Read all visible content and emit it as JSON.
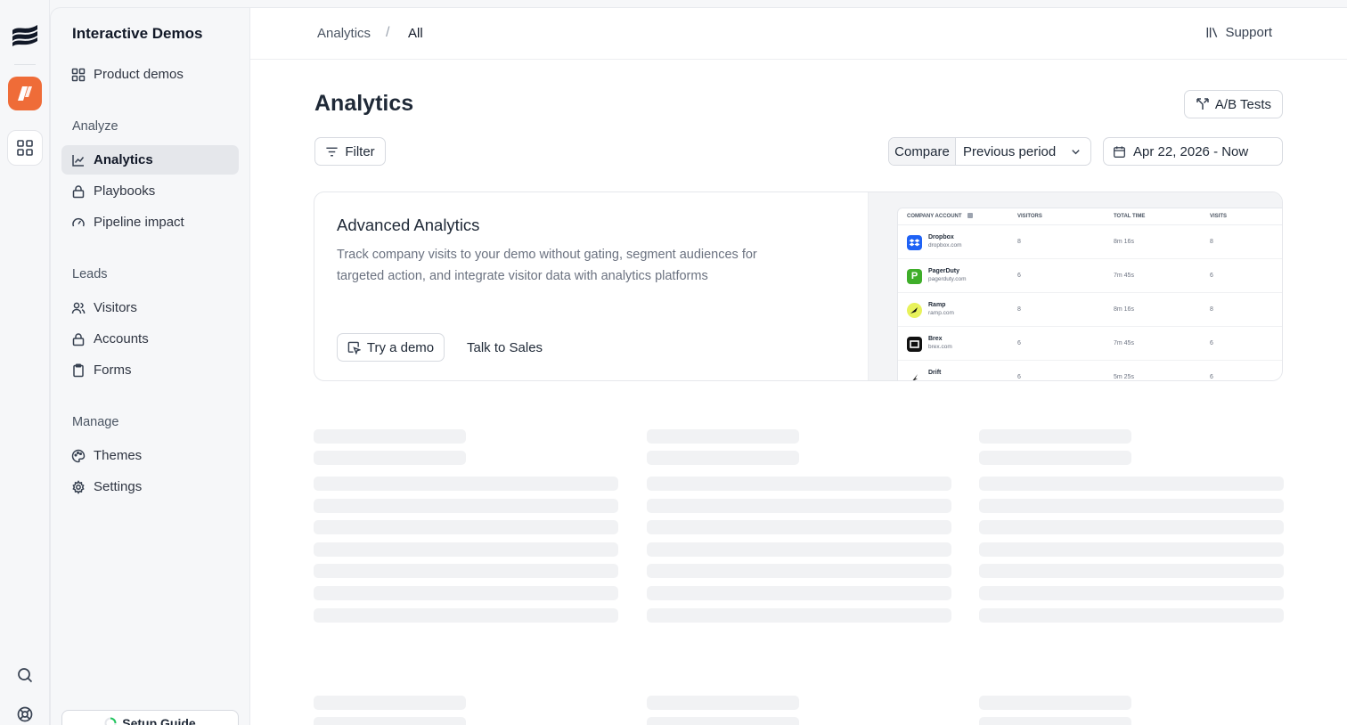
{
  "sidebar": {
    "title": "Interactive Demos",
    "top_item": "Product demos",
    "sections": {
      "analyze": "Analyze",
      "leads": "Leads",
      "manage": "Manage"
    },
    "items": {
      "analytics": "Analytics",
      "playbooks": "Playbooks",
      "pipeline": "Pipeline impact",
      "visitors": "Visitors",
      "accounts": "Accounts",
      "forms": "Forms",
      "themes": "Themes",
      "settings": "Settings"
    },
    "setup_guide": "Setup Guide"
  },
  "header": {
    "breadcrumb_root": "Analytics",
    "breadcrumb_sep": "/",
    "breadcrumb_current": "All",
    "support": "Support"
  },
  "page": {
    "title": "Analytics",
    "ab_tests": "A/B Tests",
    "filter": "Filter",
    "compare_label": "Compare",
    "compare_value": "Previous period",
    "date_range": "Apr 22, 2026 - Now"
  },
  "card": {
    "title": "Advanced Analytics",
    "description": "Track company visits to your demo without gating, segment audiences for targeted action, and integrate visitor data with analytics platforms",
    "try_demo": "Try a demo",
    "talk_sales": "Talk to Sales",
    "preview": {
      "headers": [
        "COMPANY ACCOUNT",
        "VISITORS",
        "TOTAL TIME",
        "VISITS"
      ],
      "rows": [
        {
          "name": "Dropbox",
          "domain": "dropbox.com",
          "visitors": "8",
          "time": "8m 16s",
          "visits": "8",
          "color": "#1f62f5"
        },
        {
          "name": "PagerDuty",
          "domain": "pagerduty.com",
          "visitors": "6",
          "time": "7m 45s",
          "visits": "6",
          "color": "#3fae2a"
        },
        {
          "name": "Ramp",
          "domain": "ramp.com",
          "visitors": "8",
          "time": "8m 16s",
          "visits": "8",
          "color": "#e8f25a"
        },
        {
          "name": "Brex",
          "domain": "brex.com",
          "visitors": "6",
          "time": "7m 45s",
          "visits": "6",
          "color": "#111111"
        },
        {
          "name": "Drift",
          "domain": "",
          "visitors": "6",
          "time": "5m 25s",
          "visits": "6",
          "color": "#ffffff"
        }
      ]
    }
  },
  "colors": {
    "brand_orange": "#ef6c38",
    "active_bg": "#e5e7eb",
    "skeleton": "#f1f2f4"
  }
}
